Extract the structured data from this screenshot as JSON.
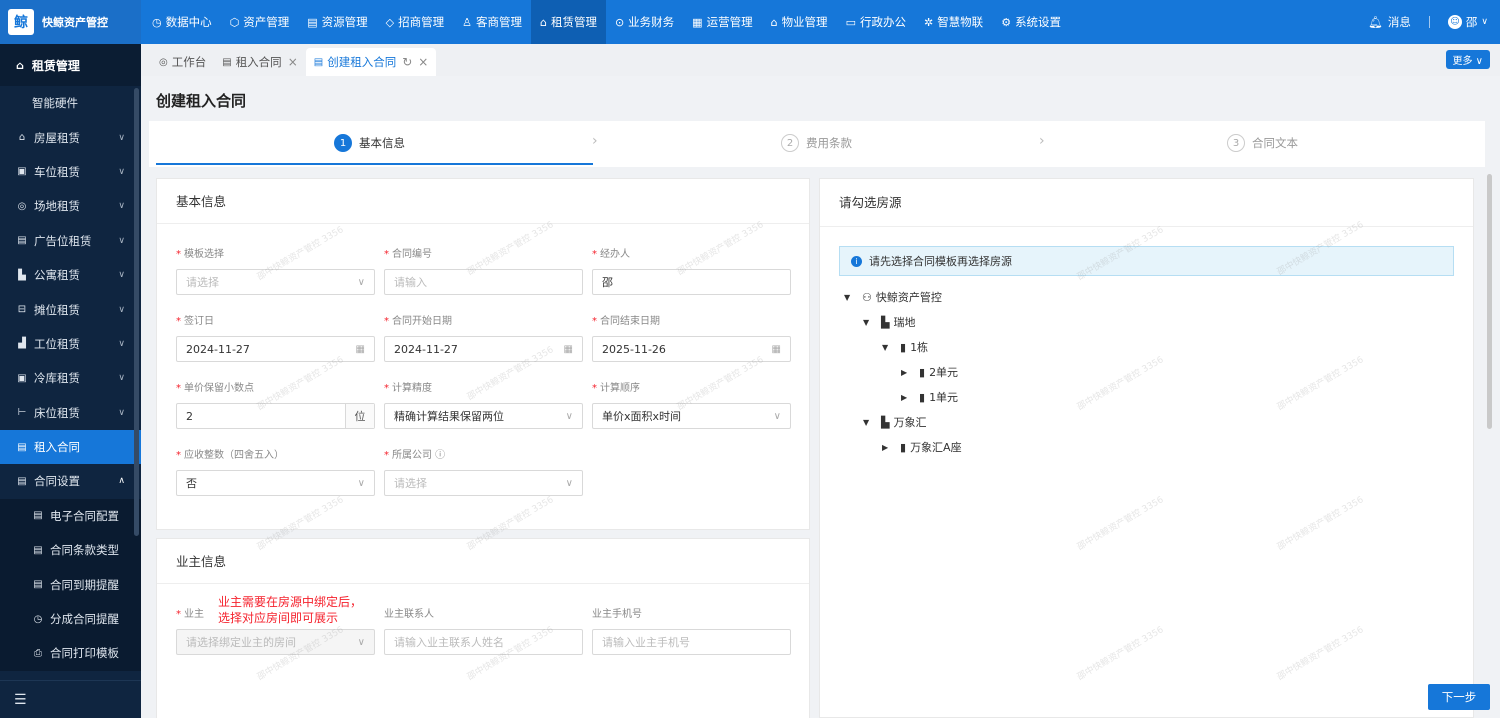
{
  "app": {
    "logo_text": "快鲸资产管控",
    "logo_glyph": "鲸"
  },
  "topnav": [
    {
      "label": "数据中心",
      "icon": "◷"
    },
    {
      "label": "资产管理",
      "icon": "⬡"
    },
    {
      "label": "资源管理",
      "icon": "▤"
    },
    {
      "label": "招商管理",
      "icon": "◇"
    },
    {
      "label": "客商管理",
      "icon": "♙"
    },
    {
      "label": "租赁管理",
      "icon": "⌂"
    },
    {
      "label": "业务财务",
      "icon": "⊙"
    },
    {
      "label": "运营管理",
      "icon": "▦"
    },
    {
      "label": "物业管理",
      "icon": "⌂"
    },
    {
      "label": "行政办公",
      "icon": "▭"
    },
    {
      "label": "智慧物联",
      "icon": "✲"
    },
    {
      "label": "系统设置",
      "icon": "⚙"
    }
  ],
  "topright": {
    "messages": "消息",
    "user": "邵",
    "user_caret": "∨"
  },
  "sidebar": {
    "header": "租赁管理",
    "items": [
      {
        "label": "智能硬件"
      },
      {
        "label": "房屋租赁",
        "icon": "⌂"
      },
      {
        "label": "车位租赁",
        "icon": "▣"
      },
      {
        "label": "场地租赁",
        "icon": "◎"
      },
      {
        "label": "广告位租赁",
        "icon": "▤"
      },
      {
        "label": "公寓租赁",
        "icon": "▙"
      },
      {
        "label": "摊位租赁",
        "icon": "⊟"
      },
      {
        "label": "工位租赁",
        "icon": "▟"
      },
      {
        "label": "冷库租赁",
        "icon": "▣"
      },
      {
        "label": "床位租赁",
        "icon": "⊢"
      },
      {
        "label": "租入合同",
        "icon": "▤"
      },
      {
        "label": "合同设置",
        "icon": "▤"
      }
    ],
    "subitems": [
      {
        "label": "电子合同配置",
        "icon": "▤"
      },
      {
        "label": "合同条款类型",
        "icon": "▤"
      },
      {
        "label": "合同到期提醒",
        "icon": "▤"
      },
      {
        "label": "分成合同提醒",
        "icon": "◷"
      },
      {
        "label": "合同打印模板",
        "icon": "⎙"
      }
    ],
    "collapse_icon": "☰"
  },
  "tabs": [
    {
      "label": "工作台",
      "icon": "◎"
    },
    {
      "label": "租入合同",
      "icon": "▤"
    },
    {
      "label": "创建租入合同",
      "icon": "▤"
    }
  ],
  "more_label": "更多 ∨",
  "page_title": "创建租入合同",
  "steps": [
    {
      "num": "1",
      "label": "基本信息"
    },
    {
      "num": "2",
      "label": "费用条款"
    },
    {
      "num": "3",
      "label": "合同文本"
    }
  ],
  "basic_info": {
    "title": "基本信息",
    "fields": [
      {
        "label": "模板选择",
        "value": "请选择",
        "placeholder": true,
        "tail": "∨"
      },
      {
        "label": "合同编号",
        "value": "请输入",
        "placeholder": true,
        "tail": ""
      },
      {
        "label": "经办人",
        "value": "邵",
        "placeholder": false,
        "tail": ""
      },
      {
        "label": "签订日",
        "value": "2024-11-27",
        "placeholder": false,
        "tail": "▦"
      },
      {
        "label": "合同开始日期",
        "value": "2024-11-27",
        "placeholder": false,
        "tail": "▦"
      },
      {
        "label": "合同结束日期",
        "value": "2025-11-26",
        "placeholder": false,
        "tail": "▦"
      },
      {
        "label": "单价保留小数点",
        "value": "2",
        "placeholder": false,
        "tail": "",
        "unit": "位"
      },
      {
        "label": "计算精度",
        "value": "精确计算结果保留两位",
        "placeholder": false,
        "tail": "∨"
      },
      {
        "label": "计算顺序",
        "value": "单价x面积x时间",
        "placeholder": false,
        "tail": "∨"
      },
      {
        "label": "应收整数（四舍五入）",
        "value": "否",
        "placeholder": false,
        "tail": "∨"
      },
      {
        "label": "所属公司 ⓘ",
        "value": "请选择",
        "placeholder": true,
        "tail": "∨"
      }
    ]
  },
  "owner_info": {
    "title": "业主信息",
    "note": "业主需要在房源中绑定后，\n选择对应房间即可展示",
    "fields": [
      {
        "label": "业主",
        "value": "请选择绑定业主的房间",
        "required": true,
        "tail": "∨"
      },
      {
        "label": "业主联系人",
        "value": "请输入业主联系人姓名",
        "required": false,
        "tail": ""
      },
      {
        "label": "业主手机号",
        "value": "请输入业主手机号",
        "required": false,
        "tail": ""
      }
    ]
  },
  "house_select": {
    "title": "请勾选房源",
    "info": "请先选择合同模板再选择房源",
    "tree": [
      {
        "label": "快鲸资产管控",
        "icon": "⚇",
        "caret": "▼"
      },
      {
        "label": "瑞地",
        "icon": "▙",
        "caret": "▼"
      },
      {
        "label": "1栋",
        "icon": "▮",
        "caret": "▼"
      },
      {
        "label": "2单元",
        "icon": "▮",
        "caret": "▶"
      },
      {
        "label": "1单元",
        "icon": "▮",
        "caret": "▶"
      },
      {
        "label": "万象汇",
        "icon": "▙",
        "caret": "▼"
      },
      {
        "label": "万象汇A座",
        "icon": "▮",
        "caret": "▶"
      }
    ]
  },
  "next_button": "下一步",
  "watermark": "邵中快鲸资产管控 3356"
}
